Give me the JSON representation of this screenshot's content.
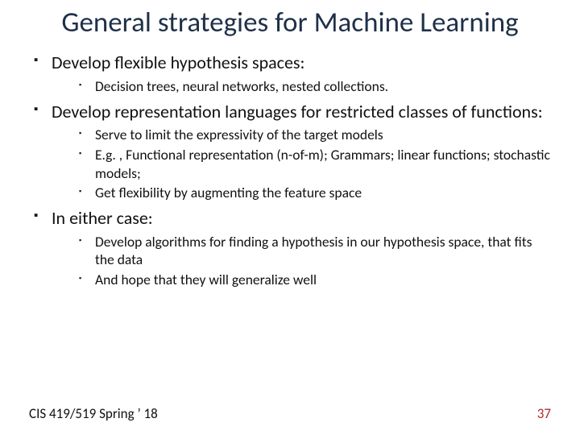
{
  "title": "General strategies for Machine Learning",
  "bullets": [
    {
      "text": "Develop flexible hypothesis spaces:",
      "sub": [
        "Decision trees, neural networks, nested collections."
      ]
    },
    {
      "text": "Develop representation languages for restricted classes of functions:",
      "sub": [
        "Serve to limit the expressivity of the target models",
        "E.g. , Functional representation (n-of-m); Grammars;  linear functions; stochastic models;",
        "Get flexibility by augmenting the feature space"
      ]
    },
    {
      "text": "In either case:",
      "sub": [
        "Develop algorithms for finding a hypothesis in our hypothesis space, that fits the data",
        "And hope that they will generalize well"
      ]
    }
  ],
  "footer": {
    "left": "CIS 419/519 Spring ’ 18",
    "page": "37"
  }
}
